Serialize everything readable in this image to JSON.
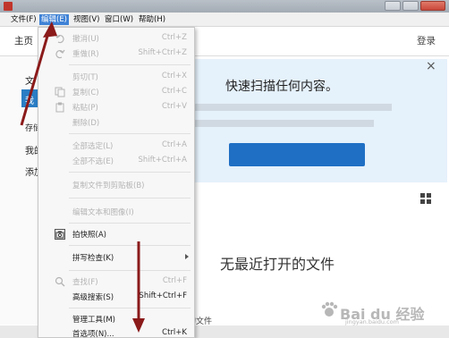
{
  "menubar": {
    "items": [
      "文件(F)",
      "编辑(E)",
      "视图(V)",
      "窗口(W)",
      "帮助(H)"
    ],
    "active_index": 1
  },
  "home": {
    "tab_label": "主页",
    "login_label": "登录",
    "left_items": [
      "文",
      "我",
      "存储",
      "我的",
      "添加"
    ]
  },
  "banner": {
    "title": "快速扫描任何内容。",
    "close_glyph": "×",
    "button_color": "#1f6fc4"
  },
  "main": {
    "no_recent": "无最近打开的文件",
    "recent_tail": "的文件"
  },
  "edit_menu": {
    "items": [
      {
        "label": "撤消(U)",
        "shortcut": "Ctrl+Z",
        "disabled": true,
        "icon": "undo-icon"
      },
      {
        "label": "重做(R)",
        "shortcut": "Shift+Ctrl+Z",
        "disabled": true,
        "icon": "redo-icon"
      },
      {
        "label": "剪切(T)",
        "shortcut": "Ctrl+X",
        "disabled": true
      },
      {
        "label": "复制(C)",
        "shortcut": "Ctrl+C",
        "disabled": true,
        "icon": "copy-icon"
      },
      {
        "label": "粘贴(P)",
        "shortcut": "Ctrl+V",
        "disabled": true,
        "icon": "paste-icon"
      },
      {
        "label": "删除(D)",
        "shortcut": "",
        "disabled": true
      },
      {
        "label": "全部选定(L)",
        "shortcut": "Ctrl+A",
        "disabled": true
      },
      {
        "label": "全部不选(E)",
        "shortcut": "Shift+Ctrl+A",
        "disabled": true
      },
      {
        "label": "复制文件到剪贴板(B)",
        "shortcut": "",
        "disabled": true
      },
      {
        "label": "编辑文本和图像(I)",
        "shortcut": "",
        "disabled": true
      },
      {
        "label": "拍快照(A)",
        "shortcut": "",
        "disabled": false,
        "icon": "camera-icon"
      },
      {
        "label": "拼写检查(K)",
        "shortcut": "",
        "disabled": false,
        "submenu": true
      },
      {
        "label": "查找(F)",
        "shortcut": "Ctrl+F",
        "disabled": true,
        "icon": "search-icon"
      },
      {
        "label": "高级搜索(S)",
        "shortcut": "Shift+Ctrl+F",
        "disabled": false
      },
      {
        "label": "管理工具(M)",
        "shortcut": "",
        "disabled": false
      },
      {
        "label": "首选项(N)...",
        "shortcut": "Ctrl+K",
        "disabled": false
      }
    ]
  },
  "watermark": {
    "text": "Bai du 经验",
    "url": "jingyan.baidu.com"
  },
  "colors": {
    "accent": "#3f82d6",
    "arrow": "#8b1a1a",
    "banner_bg": "#e5f1fb"
  }
}
